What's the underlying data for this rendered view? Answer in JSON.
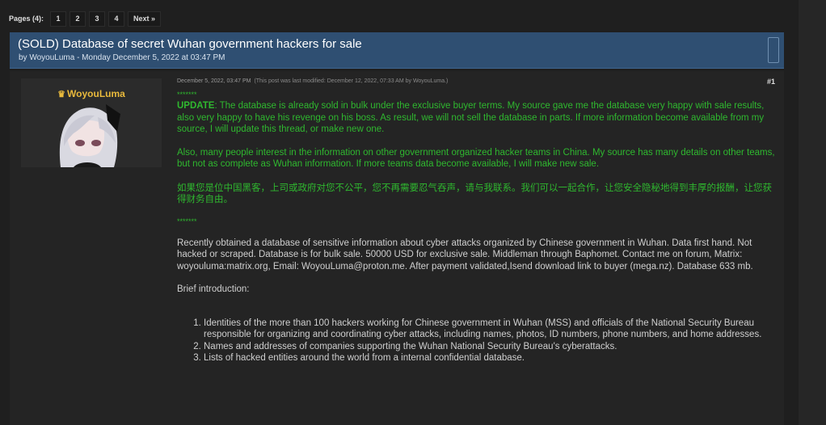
{
  "pagination": {
    "label": "Pages (4):",
    "pages": [
      "1",
      "2",
      "3",
      "4"
    ],
    "next": "Next »"
  },
  "thread": {
    "title": "(SOLD) Database of secret Wuhan government hackers for sale",
    "byline": "by WoyouLuma - Monday December 5, 2022 at 03:47 PM"
  },
  "post": {
    "username": "WoyouLuma",
    "date": "December 5, 2022, 03:47 PM",
    "modified_note": "(This post was last modified: December 12, 2022, 07:33 AM by WoyouLuma.)",
    "number": "#1",
    "stars_top": "*******",
    "update_label": "UPDATE",
    "update_text": ": The database is already sold in bulk under the exclusive buyer terms. My source gave me the database very happy with sale results, also very happy to have his revenge on his boss.  As result, we will not sell the database in parts. If more information become available from my source, I will update this thread, or make new one.",
    "also_text": "Also, many people interest in the information on other government organized hacker teams in China. My source has many details on other teams, but not as complete as Wuhan information. If more teams data become available, I will make new sale.",
    "chinese_text": "如果您是位中国黑客，上司或政府对您不公平，您不再需要忍气吞声，请与我联系。我们可以一起合作，让您安全隐秘地得到丰厚的报酬，让您获得财务自由。",
    "stars_bottom": "*******",
    "main_text": "Recently obtained a database of sensitive information about cyber attacks organized by Chinese government in Wuhan. Data first hand. Not hacked or scraped. Database is for bulk sale. 50000 USD for exclusive sale. Middleman through Baphomet. Contact me on forum, Matrix: woyouluma:matrix.org, Email: WoyouLuma@proton.me. After payment validated,Isend download link to buyer (mega.nz). Database 633 mb.",
    "brief_heading": "Brief introduction:",
    "list": [
      "Identities of the more than 100 hackers working for Chinese government in Wuhan (MSS) and officials of the National Security Bureau responsible for organizing and coordinating cyber attacks, including names, photos, ID numbers, phone numbers, and home addresses.",
      "Names and addresses of companies supporting the Wuhan National Security Bureau's cyberattacks.",
      "Lists of hacked entities around the world from a internal confidential database."
    ]
  },
  "colors": {
    "header_bg": "#2f4f72",
    "green_text": "#2fb82f",
    "username": "#e8b93c",
    "page_bg": "#1f1f1f"
  },
  "icons": {
    "crown": "crown-icon",
    "avatar": "anime-avatar"
  }
}
